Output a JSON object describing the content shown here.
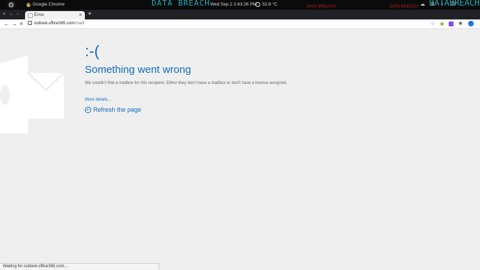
{
  "topbar": {
    "app_name": "Google Chrome",
    "clock": "Wed Sep 2   2:43:26 PM",
    "temperature": "32.8 °C",
    "neon_left": "DATA BREACH",
    "red_left": "DATA BREACH",
    "red_right": "DATA BREACH",
    "neon_right": "DATABREACH"
  },
  "tabs": [
    {
      "title": "Error"
    }
  ],
  "address_bar": {
    "host": "outlook.office365.com",
    "path": "/mail/"
  },
  "page": {
    "smiley": ":-(",
    "heading": "Something went wrong",
    "message": "We couldn't find a mailbox for this recipient. Either they don't have a mailbox or don't have a licence assigned.",
    "details_link": "More details...",
    "refresh_label": "Refresh the page"
  },
  "status_bar": "Waiting for outlook.office365.com...",
  "colors": {
    "accent": "#0f6cbd",
    "page_bg": "#efefef"
  }
}
